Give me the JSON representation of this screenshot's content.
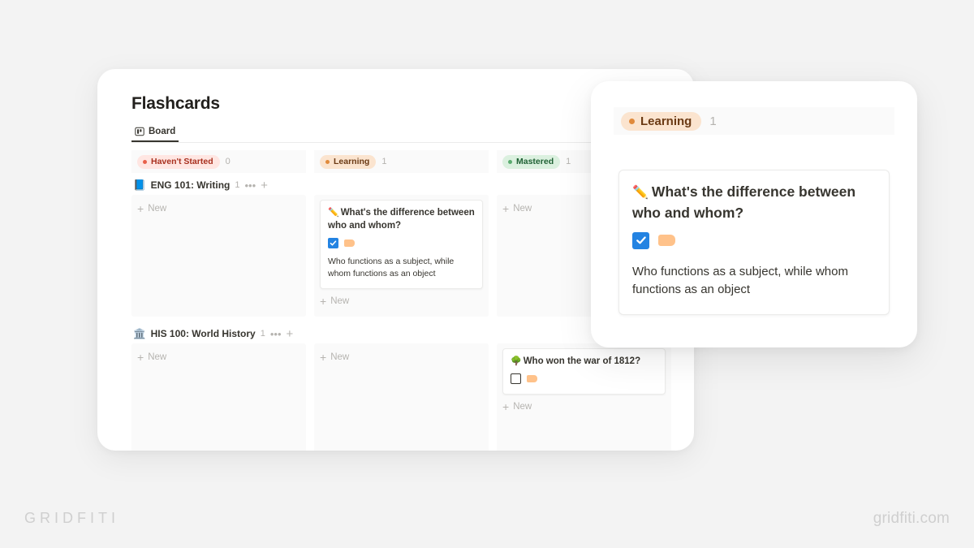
{
  "app": {
    "page_title": "Flashcards",
    "tab": {
      "label": "Board",
      "icon": "board-view-icon"
    }
  },
  "board": {
    "statuses": [
      {
        "label": "Haven't Started",
        "count": "0",
        "color": "#e8604a",
        "bg": "#ffe6e2",
        "variant": "red"
      },
      {
        "label": "Learning",
        "count": "1",
        "color": "#e08a3c",
        "bg": "#fbe4cf",
        "variant": "orange"
      },
      {
        "label": "Mastered",
        "count": "1",
        "color": "#5aab6f",
        "bg": "#dbf0df",
        "variant": "green"
      }
    ],
    "groups": [
      {
        "emoji": "📘",
        "name": "ENG 101: Writing",
        "count": "1",
        "more_label": "•••",
        "add_label": "+",
        "columns": [
          {
            "new_label": "New",
            "cards": []
          },
          {
            "new_label": "New",
            "cards": [
              {
                "emoji": "✏️",
                "title": "What's the difference between who and whom?",
                "checkbox": "checked",
                "tag_color": "#ffc28a",
                "body": "Who functions as a subject, while whom functions as an object"
              }
            ]
          },
          {
            "new_label": "New",
            "cards": []
          }
        ]
      },
      {
        "emoji": "🏛️",
        "name": "HIS 100: World History",
        "count": "1",
        "more_label": "•••",
        "add_label": "+",
        "columns": [
          {
            "new_label": "New",
            "cards": []
          },
          {
            "new_label": "New",
            "cards": []
          },
          {
            "new_label": "New",
            "cards": [
              {
                "emoji": "🌳",
                "title": "Who won the war of 1812?",
                "checkbox": "unchecked",
                "tag_color": "#ffc28a",
                "body": ""
              }
            ]
          }
        ]
      }
    ]
  },
  "peek": {
    "status": {
      "label": "Learning",
      "count": "1",
      "variant": "orange"
    },
    "card": {
      "emoji": "✏️",
      "title": "What's the difference between who and whom?",
      "checkbox": "checked",
      "tag_color": "#ffc28a",
      "body": "Who functions as a subject, while whom functions as an object"
    }
  },
  "watermarks": {
    "left": "GRIDFITI",
    "right": "gridfiti.com"
  }
}
